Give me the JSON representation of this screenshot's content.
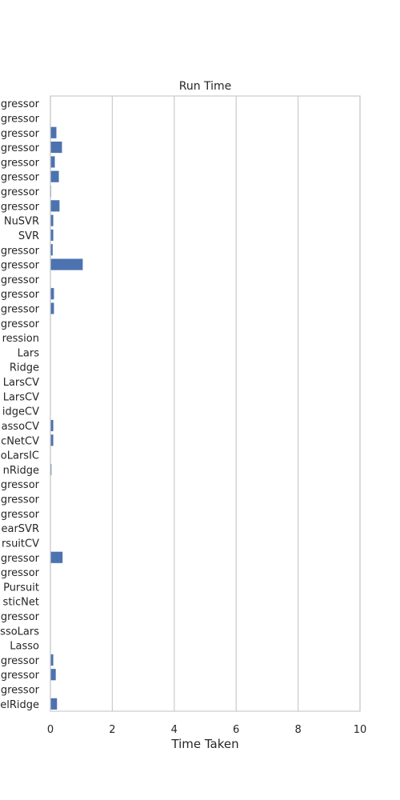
{
  "chart_data": {
    "type": "bar",
    "orientation": "horizontal",
    "title": "Run Time",
    "xlabel": "Time Taken",
    "ylabel": "",
    "xlim": [
      0,
      10
    ],
    "xticks": [
      0,
      2,
      4,
      6,
      8,
      10
    ],
    "grid": true,
    "bar_color": "#4c72b0",
    "categories": [
      "gressor",
      "gressor",
      "gressor",
      "gressor",
      "gressor",
      "gressor",
      "gressor",
      "gressor",
      "NuSVR",
      "SVR",
      "gressor",
      "gressor",
      "gressor",
      "gressor",
      "gressor",
      "gressor",
      "ression",
      "Lars",
      "Ridge",
      "LarsCV",
      "LarsCV",
      "idgeCV",
      "assoCV",
      "cNetCV",
      "oLarsIC",
      "nRidge",
      "gressor",
      "gressor",
      "gressor",
      "earSVR",
      "rsuitCV",
      "gressor",
      "gressor",
      "Pursuit",
      "sticNet",
      "gressor",
      "ssoLars",
      "Lasso",
      "gressor",
      "gressor",
      "gressor",
      "elRidge"
    ],
    "values": [
      0.0,
      0.0,
      0.2,
      0.38,
      0.15,
      0.28,
      0.03,
      0.3,
      0.1,
      0.1,
      0.08,
      1.05,
      0.0,
      0.12,
      0.12,
      0.0,
      0.0,
      0.0,
      0.0,
      0.0,
      0.0,
      0.0,
      0.1,
      0.1,
      0.0,
      0.04,
      0.0,
      0.0,
      0.0,
      0.0,
      0.0,
      0.4,
      0.0,
      0.0,
      0.0,
      0.0,
      0.0,
      0.0,
      0.1,
      0.18,
      0.0,
      0.22
    ]
  }
}
